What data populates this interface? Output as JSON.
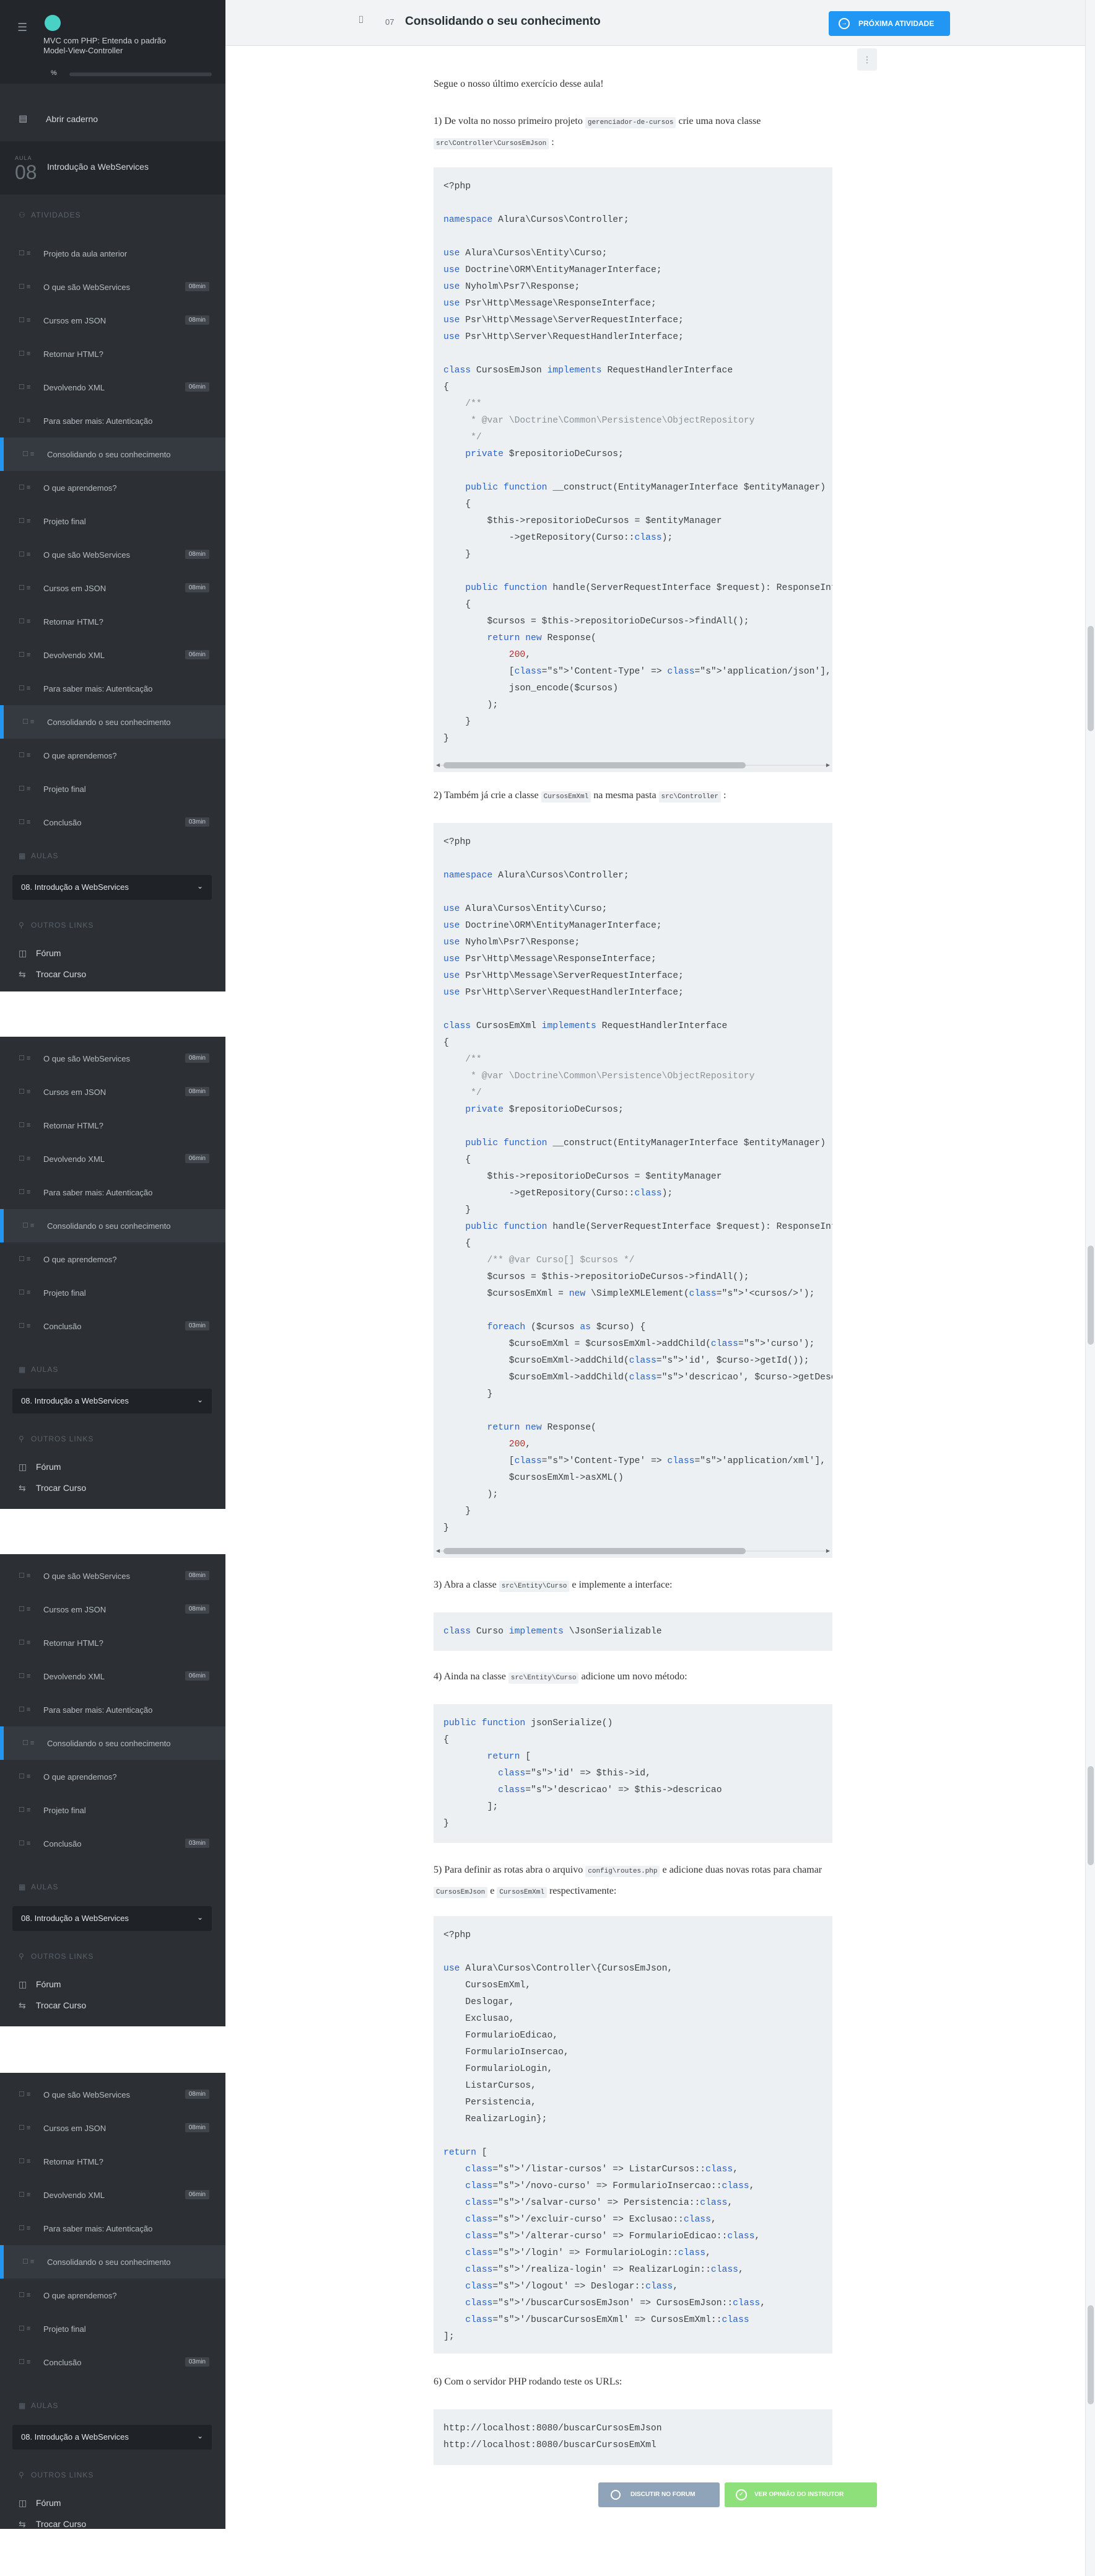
{
  "header": {
    "lesson_number": "07",
    "title": "Consolidando o seu conhecimento",
    "next_button": "PRÓXIMA ATIVIDADE"
  },
  "sidebar": {
    "course_title": "MVC com PHP: Entenda o padrão Model-View-Controller",
    "progress_label": "%",
    "progress_percent": 0,
    "open_notebook": "Abrir caderno",
    "module_label": "AULA",
    "module_number": "08",
    "module_title": "Introdução a WebServices",
    "activities_label": "ATIVIDADES",
    "items": [
      {
        "label": "Projeto da aula anterior",
        "badge": ""
      },
      {
        "label": "O que são WebServices",
        "badge": "08min"
      },
      {
        "label": "Cursos em JSON",
        "badge": "08min"
      },
      {
        "label": "Retornar HTML?",
        "badge": ""
      },
      {
        "label": "Devolvendo XML",
        "badge": "06min"
      },
      {
        "label": "Para saber mais: Autenticação",
        "badge": ""
      },
      {
        "label": "Consolidando o seu conhecimento",
        "badge": "",
        "active": true
      },
      {
        "label": "O que aprendemos?",
        "badge": ""
      },
      {
        "label": "Projeto final",
        "badge": ""
      },
      {
        "label": "O que são WebServices",
        "badge": "08min"
      },
      {
        "label": "Cursos em JSON",
        "badge": "08min"
      },
      {
        "label": "Retornar HTML?",
        "badge": ""
      },
      {
        "label": "Devolvendo XML",
        "badge": "06min"
      },
      {
        "label": "Para saber mais: Autenticação",
        "badge": ""
      },
      {
        "label": "Consolidando o seu conhecimento",
        "badge": "",
        "active": true
      },
      {
        "label": "O que aprendemos?",
        "badge": ""
      },
      {
        "label": "Projeto final",
        "badge": ""
      },
      {
        "label": "Conclusão",
        "badge": "03min"
      }
    ],
    "aulas_label": "AULAS",
    "module_select": "08. Introdução a WebServices",
    "outros_label": "OUTROS LINKS",
    "links": [
      "Fórum",
      "Trocar Curso"
    ]
  },
  "content": {
    "p0": "Segue o nosso último exercício desse aula!",
    "p1_a": "1) De volta no nosso primeiro projeto ",
    "p1_code1": "gerenciador-de-cursos",
    "p1_b": " crie uma nova classe ",
    "p1_code2": "src\\Controller\\CursosEmJson",
    "p1_c": " :",
    "p2_a": "2) Também já crie a classe ",
    "p2_code1": "CursosEmXml",
    "p2_b": " na mesma pasta ",
    "p2_code2": "src\\Controller",
    "p2_c": " :",
    "p3_a": "3) Abra a classe ",
    "p3_code1": "src\\Entity\\Curso",
    "p3_b": " e implemente a interface:",
    "p4_a": "4) Ainda na classe ",
    "p4_code1": "src\\Entity\\Curso",
    "p4_b": " adicione um novo método:",
    "p5_a": "5) Para definir as rotas abra o arquivo ",
    "p5_code1": "config\\routes.php",
    "p5_b": " e adicione duas novas rotas para chamar ",
    "p5_code2": "CursosEmJson",
    "p5_c": " e ",
    "p5_code3": "CursosEmXml",
    "p5_d": " respectivamente:",
    "p6": "6) Com o servidor PHP rodando teste os URLs:",
    "btn_forum": "DISCUTIR NO FORUM",
    "btn_solution": "VER OPINIÃO DO INSTRUTOR"
  },
  "code1": "<?php\n\nnamespace Alura\\Cursos\\Controller;\n\nuse Alura\\Cursos\\Entity\\Curso;\nuse Doctrine\\ORM\\EntityManagerInterface;\nuse Nyholm\\Psr7\\Response;\nuse Psr\\Http\\Message\\ResponseInterface;\nuse Psr\\Http\\Message\\ServerRequestInterface;\nuse Psr\\Http\\Server\\RequestHandlerInterface;\n\nclass CursosEmJson implements RequestHandlerInterface\n{\n    /**\n     * @var \\Doctrine\\Common\\Persistence\\ObjectRepository\n     */\n    private $repositorioDeCursos;\n\n    public function __construct(EntityManagerInterface $entityManager)\n    {\n        $this->repositorioDeCursos = $entityManager\n            ->getRepository(Curso::class);\n    }\n\n    public function handle(ServerRequestInterface $request): ResponseInterface\n    {\n        $cursos = $this->repositorioDeCursos->findAll();\n        return new Response(\n            200,\n            ['Content-Type' => 'application/json'],\n            json_encode($cursos)\n        );\n    }\n}",
  "code2": "<?php\n\nnamespace Alura\\Cursos\\Controller;\n\nuse Alura\\Cursos\\Entity\\Curso;\nuse Doctrine\\ORM\\EntityManagerInterface;\nuse Nyholm\\Psr7\\Response;\nuse Psr\\Http\\Message\\ResponseInterface;\nuse Psr\\Http\\Message\\ServerRequestInterface;\nuse Psr\\Http\\Server\\RequestHandlerInterface;\n\nclass CursosEmXml implements RequestHandlerInterface\n{\n    /**\n     * @var \\Doctrine\\Common\\Persistence\\ObjectRepository\n     */\n    private $repositorioDeCursos;\n\n    public function __construct(EntityManagerInterface $entityManager)\n    {\n        $this->repositorioDeCursos = $entityManager\n            ->getRepository(Curso::class);\n    }\n    public function handle(ServerRequestInterface $request): ResponseInterface\n    {\n        /** @var Curso[] $cursos */\n        $cursos = $this->repositorioDeCursos->findAll();\n        $cursosEmXml = new \\SimpleXMLElement('<cursos/>');\n\n        foreach ($cursos as $curso) {\n            $cursoEmXml = $cursosEmXml->addChild('curso');\n            $cursoEmXml->addChild('id', $curso->getId());\n            $cursoEmXml->addChild('descricao', $curso->getDescricao());\n        }\n\n        return new Response(\n            200,\n            ['Content-Type' => 'application/xml'],\n            $cursosEmXml->asXML()\n        );\n    }\n}",
  "code3": "class Curso implements \\JsonSerializable",
  "code4": "public function jsonSerialize()\n{\n        return [\n          'id' => $this->id,\n          'descricao' => $this->descricao\n        ];\n}",
  "code5": "<?php\n\nuse Alura\\Cursos\\Controller\\{CursosEmJson,\n    CursosEmXml,\n    Deslogar,\n    Exclusao,\n    FormularioEdicao,\n    FormularioInsercao,\n    FormularioLogin,\n    ListarCursos,\n    Persistencia,\n    RealizarLogin};\n\nreturn [\n    '/listar-cursos' => ListarCursos::class,\n    '/novo-curso' => FormularioInsercao::class,\n    '/salvar-curso' => Persistencia::class,\n    '/excluir-curso' => Exclusao::class,\n    '/alterar-curso' => FormularioEdicao::class,\n    '/login' => FormularioLogin::class,\n    '/realiza-login' => RealizarLogin::class,\n    '/logout' => Deslogar::class,\n    '/buscarCursosEmJson' => CursosEmJson::class,\n    '/buscarCursosEmXml' => CursosEmXml::class\n];",
  "code6": "http://localhost:8080/buscarCursosEmJson\nhttp://localhost:8080/buscarCursosEmXml"
}
